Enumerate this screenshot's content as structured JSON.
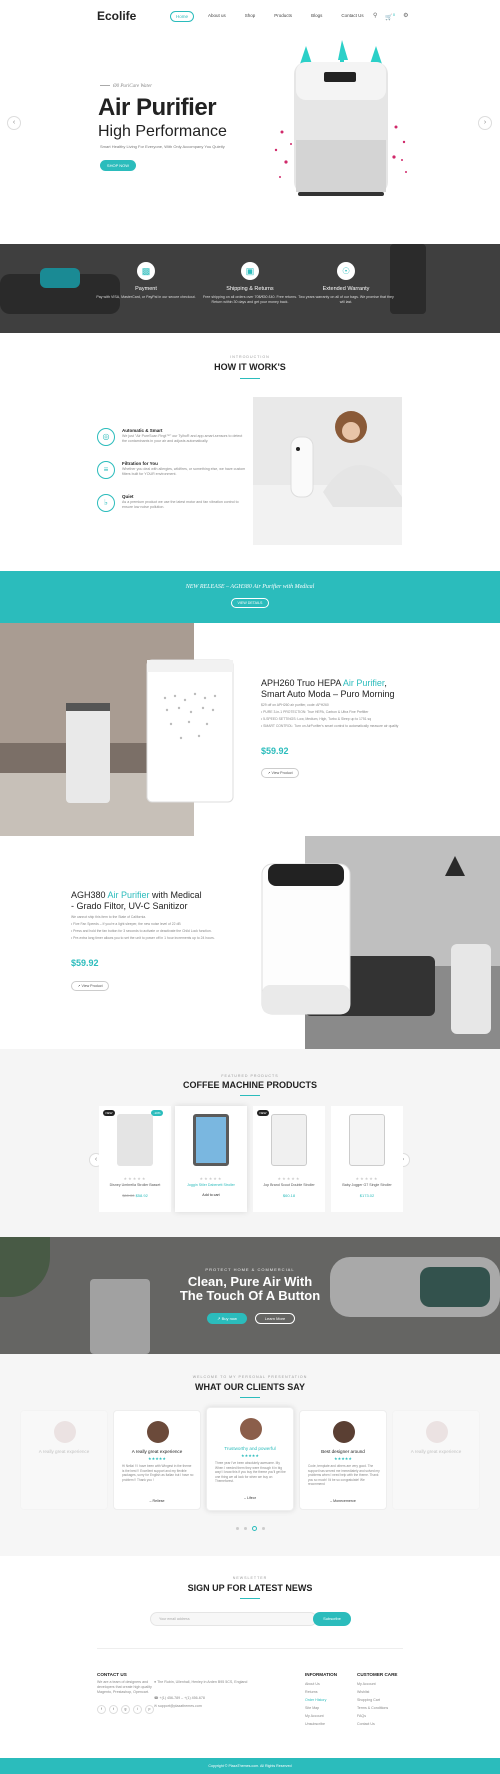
{
  "header": {
    "logo": "Ecolife",
    "nav": [
      "Home",
      "About us",
      "Shop",
      "Products",
      "Blogs",
      "Contact Us"
    ],
    "cart_count": "0"
  },
  "hero": {
    "kicker": "Ø0 PuriCare Water",
    "title_1": "Air Purifier",
    "title_2": "High Performance",
    "desc": "Smart Healthy Living For Everyone, With Only Accompany You Quietly",
    "button": "SHOP NOW"
  },
  "features": [
    {
      "icon": "card-icon",
      "title": "Payment",
      "text": "Pay with VISA, MasterCard, or PayPal in our secure checkout."
    },
    {
      "icon": "box-icon",
      "title": "Shipping & Returns",
      "text": "Free shipping on all orders over 70$/€50 £40. Free returns. Return within 30 days and get your money back."
    },
    {
      "icon": "shield-icon",
      "title": "Extended Warranty",
      "text": "Two years warranty on all of our bags. We promise that they will last."
    }
  ],
  "how": {
    "kicker": "INTRODUCTION",
    "title": "HOW IT WORK'S",
    "steps": [
      {
        "title": "Automatic & Smart",
        "text": "We just \"Air PureScan Fingt™\" our TylhoR and app-smart-sensors to detect the contaminants in your air and adjusts automatically."
      },
      {
        "title": "Filtration for You",
        "text": "Whether you deal with allergies, wildfires, or something else, we have custom filters built for YOUR environment."
      },
      {
        "title": "Quiet",
        "text": "As a premium product we use the latest motor and fan vibration control to ensure low noise pollution."
      }
    ]
  },
  "release": {
    "text": "NEW RELEASE – AGH380 Air Purifier with Medical",
    "button": "VIEW DETAILS"
  },
  "product1": {
    "title_a": "APH260 Truo HEPA ",
    "title_acc": "Air Purifier",
    "title_b": ",",
    "title_c": "Smart Auto Moda – Puro Morning",
    "specs": [
      "$29 off on APH260 air purifier, code: APH260",
      "• PURE 3-in-1 PROTECTION: True HEPA, Carbon & Ultra Fine Prefilter",
      "• 5-SPEED SETTINGS: Low, Medium, High, Turbo & Sleep up to 1751 sq",
      "• SMART CONTROL: Turn on AirPurifier's smart control to automatically measure air quality"
    ],
    "price": "$59.92",
    "button": "View Product"
  },
  "product2": {
    "title_a": "AGH380 ",
    "title_acc": "Air Purifier",
    "title_b": " with Medical",
    "title_c": "- Grado Filtor, UV-C Sanitizor",
    "specs": [
      "We cannot ship this item to the State of California.",
      "• Five Fan Speeds – If you're a light sleeper, the new noise level of 22 dB",
      "• Press and hold the fan button for 3 seconds to activate or deactivate the Child Lock function.",
      "• Pre-extra long timer allows you to set the unit to power off in 1 hour increments up to 24 hours."
    ],
    "price": "$59.92",
    "button": "View Product"
  },
  "coffee": {
    "kicker": "FEATURED PRODUCTS",
    "title": "COFFEE MACHINE PRODUCTS",
    "products": [
      {
        "name": "Disney Umbrella Stroller Basset",
        "old_price": "$60.00",
        "price": "$58.92",
        "badges": [
          "NEW",
          "-10%"
        ]
      },
      {
        "name": "Joggin Stiler Dabenett Stroller",
        "old_price": "",
        "price": "Add to cart",
        "badges": []
      },
      {
        "name": "Jop Brand Scout Double Stroller",
        "old_price": "",
        "price": "$60.18",
        "badges": [
          "NEW"
        ]
      },
      {
        "name": "Baby Jogger G7 Single Stroller",
        "old_price": "",
        "price": "$173.02",
        "badges": []
      }
    ]
  },
  "clean": {
    "kicker": "PROTECT HOME & COMMERCIAL",
    "title_1": "Clean, Pure Air With",
    "title_2": "The Touch Of A Button",
    "button_1": "Buy now",
    "button_2": "Learn More"
  },
  "clients": {
    "kicker": "WELCOME TO MY PERSONAL PRESENTATION",
    "title": "WHAT OUR CLIENTS SAY",
    "items": [
      {
        "title": "A really great experience",
        "text": "Hi Nellai !! I have been with Wingest in the theme is the best !! Excellent support and my flexible packages, sorry for English as Italian but I have no problem !! Thank you !",
        "name": "Reliese"
      },
      {
        "title": "Trustworthy and powerful",
        "text": "Three year I've been absolutely awesome. My When I needed them they were through it in big way! I know this if you buy the theme you'll get the one thing we all look for when we buy on Themeforest.",
        "name": "Lifeor"
      },
      {
        "title": "Best designer around",
        "text": "Code, template and others are very good. The support has served me immediately and solved my problems when I need help with the theme. Thank you so much! I'd be so congratulate! We recommend",
        "name": "Monecemerce"
      }
    ],
    "ghost_title": "A really great experience"
  },
  "newsletter": {
    "kicker": "NEWSLETTER",
    "title": "SIGN UP FOR LATEST NEWS",
    "placeholder": "Your email address",
    "button": "Subscribe"
  },
  "footer": {
    "contact_title": "CONTACT US",
    "contact_text": "We are a team of designers and developers that create high quality Magento, Prestashop, Opencart.",
    "address": "The Rubin, Ullenhall, Henley in Arden B95 5CS, England",
    "phone": "+(1) 456-789 – +(1) 456-678",
    "email": "support@plazathemes.com",
    "info_title": "INFORMATION",
    "info_links": [
      "About Us",
      "Returns",
      "Order History",
      "Site Map",
      "My Account",
      "Unsubscribe"
    ],
    "care_title": "CUSTOMER CARE",
    "care_links": [
      "My Account",
      "Wishlist",
      "Shopping Cart",
      "Terms & Conditions",
      "FAQs",
      "Contact Us"
    ],
    "copyright": "Copyright © PlazaThemes.com. All Rights Reserved"
  }
}
